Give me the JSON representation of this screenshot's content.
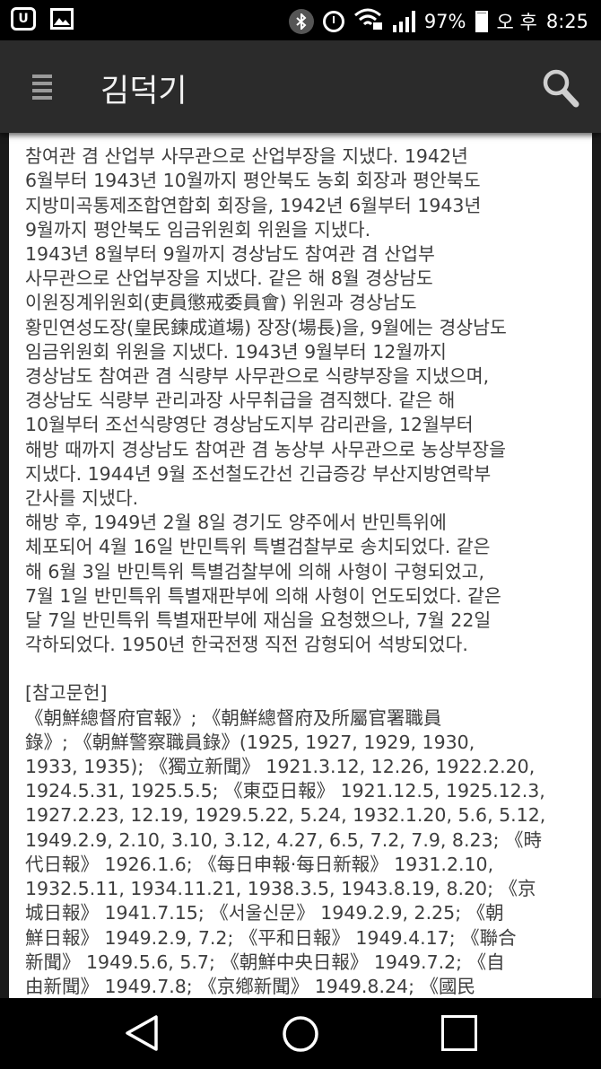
{
  "status_bar": {
    "battery_percent": "97%",
    "ampm": "오 후",
    "time": "8:25",
    "left_icons": [
      "u-plus-icon",
      "gallery-icon"
    ],
    "right_icons": [
      "bluetooth-icon",
      "alarm-icon",
      "wifi-lock-icon",
      "signal-icon",
      "battery-icon"
    ]
  },
  "app_bar": {
    "title": "김덕기",
    "menu_icon": "hamburger-menu-icon",
    "search_icon": "search-icon"
  },
  "article": {
    "lines_p1": [
      "참여관 겸 산업부 사무관으로 산업부장을 지냈다. 1942년",
      "6월부터 1943년 10월까지 평안북도 농회 회장과 평안북도",
      "지방미곡통제조합연합회 회장을, 1942년 6월부터 1943년",
      "9월까지 평안북도 임금위원회 위원을 지냈다."
    ],
    "lines_p2": [
      "1943년 8월부터 9월까지 경상남도 참여관 겸 산업부",
      "사무관으로 산업부장을 지냈다. 같은 해 8월 경상남도",
      "이원징계위원회(吏員懲戒委員會) 위원과 경상남도",
      "황민연성도장(皇民鍊成道場) 장장(場長)을, 9월에는 경상남도",
      "임금위원회 위원을 지냈다. 1943년 9월부터 12월까지",
      "경상남도 참여관 겸 식량부 사무관으로 식량부장을 지냈으며,",
      "경상남도 식량부 관리과장 사무취급을 겸직했다. 같은 해",
      "10월부터 조선식량영단 경상남도지부 감리관을, 12월부터",
      "해방 때까지 경상남도 참여관 겸 농상부 사무관으로 농상부장을",
      "지냈다. 1944년 9월 조선철도간선 긴급증강 부산지방연락부",
      "간사를 지냈다."
    ],
    "lines_p3": [
      "해방 후, 1949년 2월 8일 경기도 양주에서 반민특위에",
      "체포되어 4월 16일 반민특위 특별검찰부로 송치되었다. 같은",
      "해 6월 3일 반민특위 특별검찰부에 의해 사형이 구형되었고,",
      "7월 1일 반민특위 특별재판부에 의해 사형이 언도되었다. 같은",
      "달 7일 반민특위 특별재판부에 재심을 요청했으나, 7월 22일",
      "각하되었다. 1950년 한국전쟁 직전 감형되어 석방되었다."
    ],
    "references_heading": "[참고문헌]",
    "lines_refs": [
      "《朝鮮總督府官報》; 《朝鮮總督府及所屬官署職員",
      "錄》; 《朝鮮警察職員錄》(1925, 1927, 1929, 1930,",
      "1933, 1935); 《獨立新聞》 1921.3.12, 12.26, 1922.2.20,",
      "1924.5.31, 1925.5.5; 《東亞日報》 1921.12.5, 1925.12.3,",
      "1927.2.23, 12.19, 1929.5.22, 5.24, 1932.1.20, 5.6, 5.12,",
      "1949.2.9, 2.10, 3.10, 3.12, 4.27, 6.5, 7.2, 7.9, 8.23; 《時",
      "代日報》 1926.1.6; 《每日申報·每日新報》 1931.2.10,",
      "1932.5.11, 1934.11.21, 1938.3.5, 1943.8.19, 8.20; 《京",
      "城日報》 1941.7.15; 《서울신문》 1949.2.9, 2.25; 《朝",
      "鮮日報》 1949.2.9, 7.2; 《平和日報》 1949.4.17; 《聯合",
      "新聞》 1949.5.6, 5.7; 《朝鮮中央日報》 1949.7.2; 《自",
      "由新聞》 1949.7.8; 《京鄕新聞》 1949.8.24; 《國民"
    ]
  },
  "nav_bar": {
    "buttons": [
      "back-icon",
      "home-icon",
      "recent-apps-icon"
    ]
  }
}
